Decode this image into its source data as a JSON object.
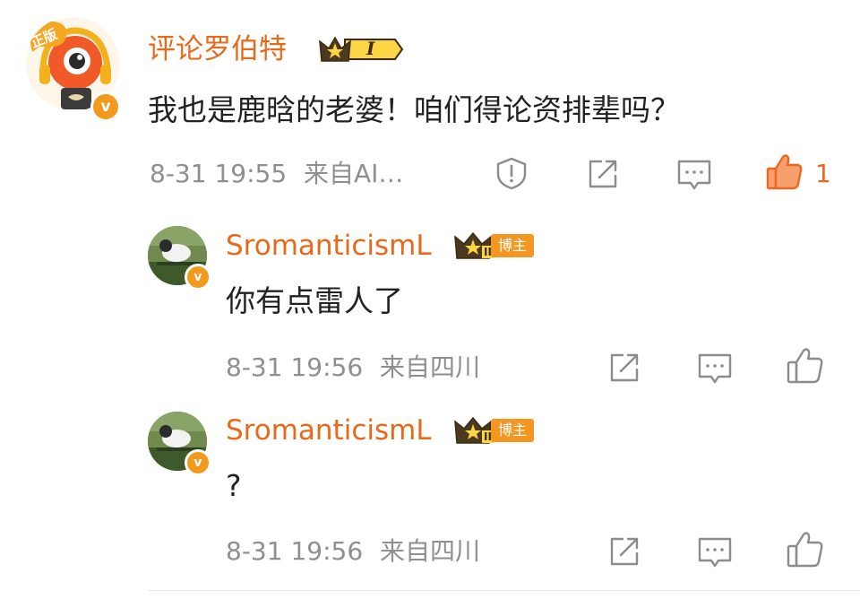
{
  "comment": {
    "username": "评论罗伯特",
    "text": "我也是鹿晗的老婆！咱们得论资排辈吗？",
    "time": "8-31 19:55",
    "source": "来自AI…",
    "like_count": "1",
    "avatar_label": "正版",
    "rank_label": "I",
    "colors": {
      "accent": "#e9691a",
      "liked": "#f0651f"
    }
  },
  "replies": [
    {
      "username": "SromanticismL",
      "tag": "博主",
      "text": "你有点雷人了",
      "time": "8-31 19:56",
      "source": "来自四川"
    },
    {
      "username": "SromanticismL",
      "tag": "博主",
      "text": "?",
      "time": "8-31 19:56",
      "source": "来自四川"
    }
  ],
  "badge": {
    "verified": "v",
    "crown_level": "II"
  }
}
